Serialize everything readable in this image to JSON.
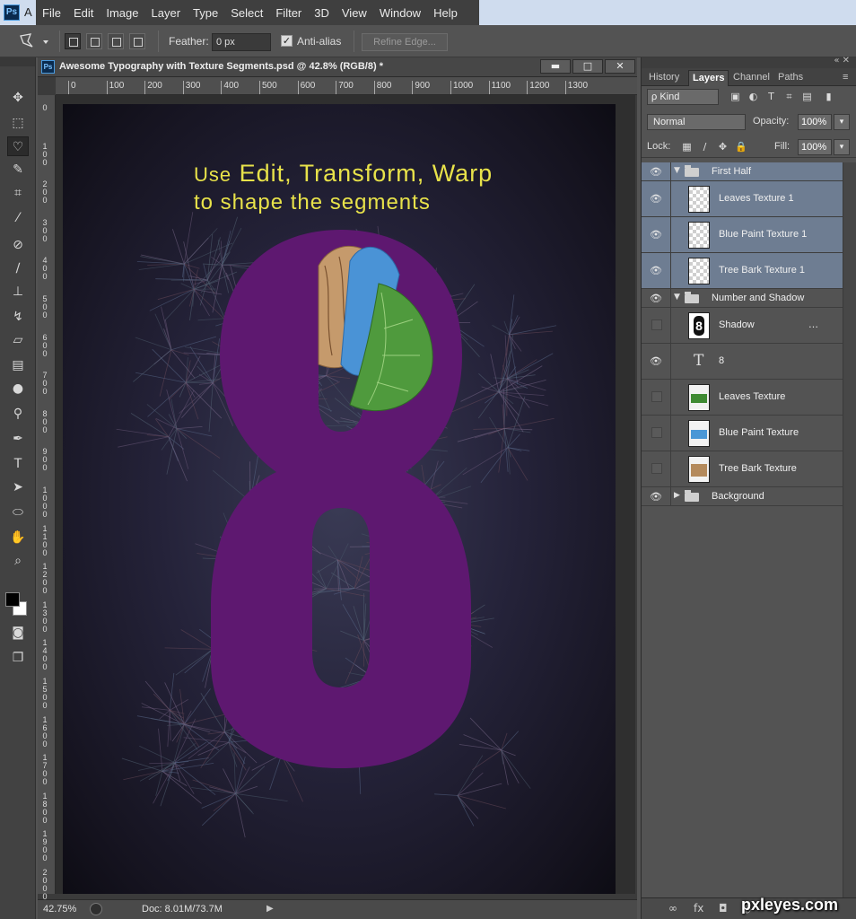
{
  "app": {
    "badge": "Ps",
    "title_letter": "A"
  },
  "menu": [
    "File",
    "Edit",
    "Image",
    "Layer",
    "Type",
    "Select",
    "Filter",
    "3D",
    "View",
    "Window",
    "Help"
  ],
  "options_bar": {
    "feather_label": "Feather:",
    "feather_value": "0 px",
    "antialias_label": "Anti-alias",
    "antialias_checked": true,
    "refine_edge_label": "Refine Edge..."
  },
  "document": {
    "badge": "Ps",
    "title": "Awesome Typography with Texture Segments.psd @ 42.8% (RGB/8) *",
    "window_buttons": [
      "▬",
      "□",
      "✕"
    ],
    "ruler_h": [
      "0",
      "100",
      "200",
      "300",
      "400",
      "500",
      "600",
      "700",
      "800",
      "900",
      "1000",
      "1100",
      "1200",
      "1300"
    ],
    "ruler_v": [
      "0",
      "1 0 0",
      "2 0 0",
      "3 0 0",
      "4 0 0",
      "5 0 0",
      "6 0 0",
      "7 0 0",
      "8 0 0",
      "9 0 0",
      "1 0 0 0",
      "1 1 0 0",
      "1 2 0 0",
      "1 3 0 0",
      "1 4 0 0",
      "1 5 0 0",
      "1 6 0 0",
      "1 7 0 0",
      "1 8 0 0",
      "1 9 0 0",
      "2 0 0 0"
    ],
    "heading_line1_prefix": "Use",
    "heading_line1_rest": "Edit, Transform, Warp",
    "heading_line2": "to shape the segments",
    "big_number": "8",
    "colors": {
      "number_fill": "#5e1870",
      "heading": "#e8e24a"
    }
  },
  "status": {
    "zoom": "42.75%",
    "doc_size": "Doc: 8.01M/73.7M"
  },
  "panel": {
    "tabs": [
      "History",
      "Layers",
      "Channel",
      "Paths"
    ],
    "active_tab": "Layers",
    "kind_label": "ρ Kind",
    "blend_mode": "Normal",
    "opacity_label": "Opacity:",
    "opacity_value": "100%",
    "lock_label": "Lock:",
    "fill_label": "Fill:",
    "fill_value": "100%",
    "layers": [
      {
        "name": "First Half",
        "kind": "group"
      },
      {
        "name": "Leaves Texture 1",
        "kind": "transparent"
      },
      {
        "name": "Blue Paint Texture 1",
        "kind": "transparent"
      },
      {
        "name": "Tree Bark Texture 1",
        "kind": "transparent"
      },
      {
        "name": "Number and Shadow",
        "kind": "group"
      },
      {
        "name": "Shadow",
        "kind": "shadow",
        "thumb_glyph": "8"
      },
      {
        "name": "8",
        "kind": "type",
        "thumb_glyph": "T"
      },
      {
        "name": "Leaves Texture",
        "kind": "leaves"
      },
      {
        "name": "Blue Paint Texture",
        "kind": "blue"
      },
      {
        "name": "Tree Bark Texture",
        "kind": "bark"
      },
      {
        "name": "Background",
        "kind": "group"
      }
    ]
  },
  "watermark": "pxleyes.com"
}
